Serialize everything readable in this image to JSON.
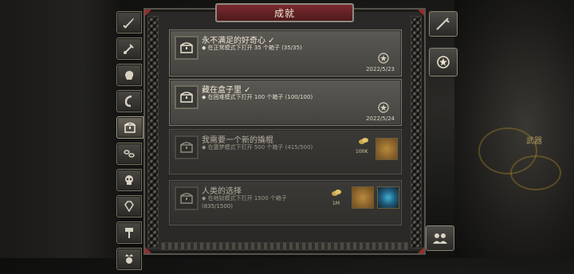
{
  "window": {
    "title": "成就"
  },
  "side_labels": {
    "weapon": "武器"
  },
  "tabs": [
    {
      "icon": "sword-icon"
    },
    {
      "icon": "dagger-icon"
    },
    {
      "icon": "fist-icon"
    },
    {
      "icon": "hook-icon"
    },
    {
      "icon": "chest-icon",
      "active": true
    },
    {
      "icon": "chain-icon"
    },
    {
      "icon": "skull-icon"
    },
    {
      "icon": "gem-icon"
    },
    {
      "icon": "hammer-icon"
    },
    {
      "icon": "skull-crown-icon"
    }
  ],
  "achievements": [
    {
      "title": "永不满足的好奇心 ✓",
      "desc": "◆ 在正常模式下打开 35 个箱子 (35/35)",
      "progress": "",
      "date": "2022/5/23",
      "completed": true
    },
    {
      "title": "藏在盒子里 ✓",
      "desc": "◆ 在困难模式下打开 100 个箱子 (100/100)",
      "progress": "",
      "date": "2022/5/24",
      "completed": true
    },
    {
      "title": "我需要一个新的撬棍",
      "desc": "◆ 在噩梦模式下打开 500 个箱子 (415/500)",
      "progress": "",
      "reward_label": "100K",
      "completed": false
    },
    {
      "title": "人类的选择",
      "desc": "◆ 在地狱模式下打开 1500 个箱子",
      "progress": "(835/1500)",
      "reward_label": "1M",
      "completed": false
    }
  ],
  "colors": {
    "title_bar": "#7a2a2f",
    "accent_red": "#9a2c2c",
    "gold": "#c9a64a"
  }
}
